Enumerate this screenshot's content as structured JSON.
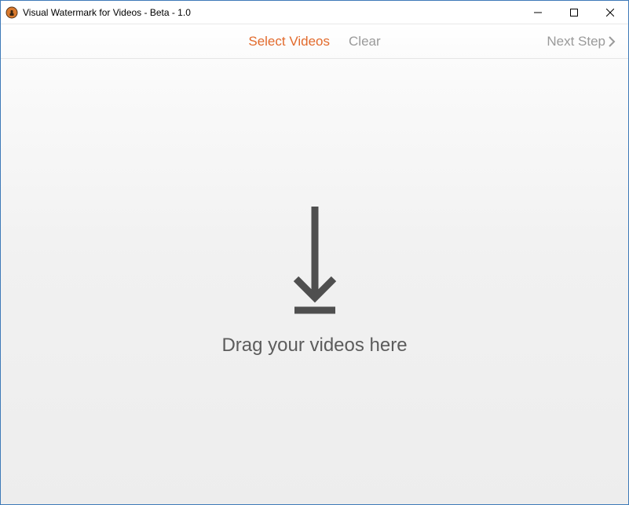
{
  "window": {
    "title": "Visual Watermark for Videos - Beta - 1.0"
  },
  "toolbar": {
    "select_videos": "Select Videos",
    "clear": "Clear",
    "next_step": "Next Step"
  },
  "dropzone": {
    "message": "Drag your videos here"
  },
  "colors": {
    "accent": "#e26a2c",
    "muted": "#9a9a9a",
    "arrow": "#4f4f4f",
    "border": "#3e7ab8"
  }
}
